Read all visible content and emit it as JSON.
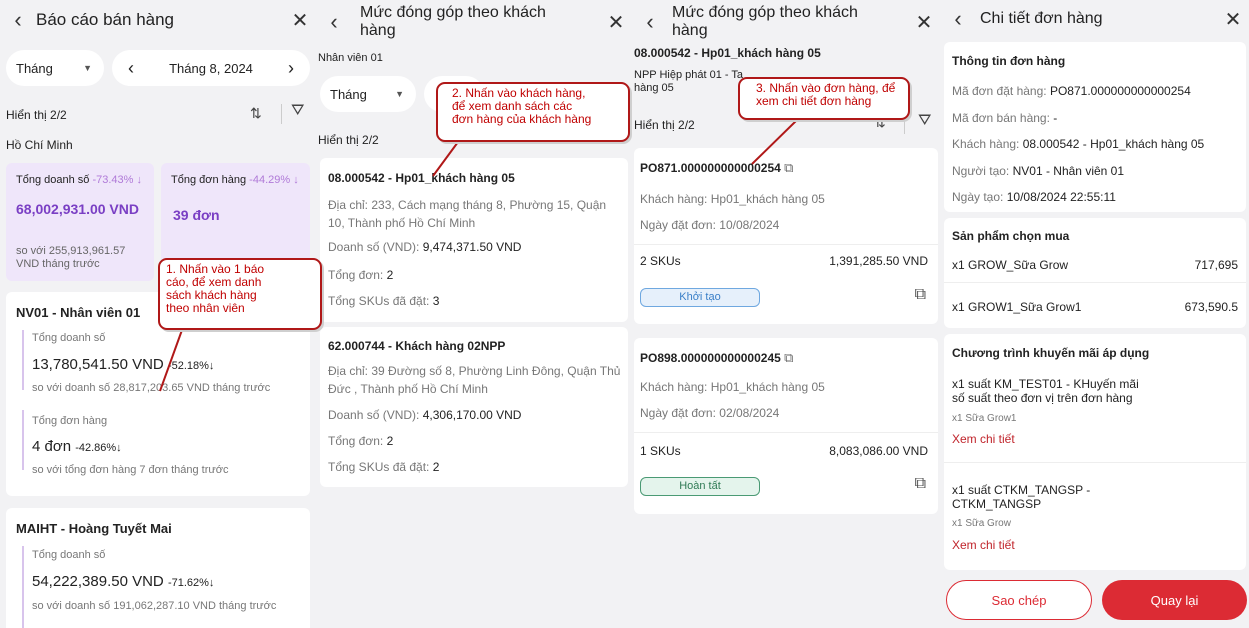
{
  "p1": {
    "title": "Báo cáo bán hàng",
    "period": "Tháng",
    "month": "Tháng 8, 2024",
    "count": "Hiển thị 2/2",
    "region": "Hồ Chí Minh",
    "stat1": {
      "label": "Tổng doanh số",
      "delta": "-73.43% ↓",
      "value": "68,002,931.00 VND",
      "compare": "so với 255,913,961.57 VND tháng trước"
    },
    "stat2": {
      "label": "Tổng đơn hàng",
      "delta": "-44.29% ↓",
      "value": "39 đơn"
    },
    "emp1": {
      "name": "NV01 - Nhân viên 01",
      "rev_label": "Tổng doanh số",
      "rev_value": "13,780,541.50 VND",
      "rev_delta": "-52.18%↓",
      "rev_compare": "so với doanh số 28,817,203.65 VND tháng trước",
      "ord_label": "Tổng đơn hàng",
      "ord_value": "4 đơn",
      "ord_delta": "-42.86%↓",
      "ord_compare": "so với tổng đơn hàng 7 đơn tháng trước"
    },
    "emp2": {
      "name": "MAIHT - Hoàng Tuyết Mai",
      "rev_label": "Tổng doanh số",
      "rev_value": "54,222,389.50 VND",
      "rev_delta": "-71.62%↓",
      "rev_compare": "so với doanh số 191,062,287.10 VND tháng trước"
    }
  },
  "p2": {
    "title": "Mức đóng góp theo khách hàng",
    "employee": "Nhân viên 01",
    "period": "Tháng",
    "count": "Hiển thị 2/2",
    "c1": {
      "name": "08.000542 - Hp01_khách hàng 05",
      "addr": "Địa chỉ: 233, Cách mạng tháng 8, Phường 15, Quận 10, Thành phố Hồ Chí Minh",
      "rev_label": "Doanh số (VND):",
      "rev": "9,474,371.50 VND",
      "ord_label": "Tổng đơn:",
      "ord": "2",
      "sku_label": "Tổng SKUs đã đặt:",
      "sku": "3"
    },
    "c2": {
      "name": "62.000744 - Khách hàng 02NPP",
      "addr": "Địa chỉ: 39 Đường số 8, Phường Linh Đông, Quận Thủ Đức , Thành phố Hồ Chí Minh",
      "rev_label": "Doanh số (VND):",
      "rev": "4,306,170.00 VND",
      "ord_label": "Tổng đơn:",
      "ord": "2",
      "sku_label": "Tổng SKUs đã đặt:",
      "sku": "2"
    }
  },
  "p3": {
    "title": "Mức đóng góp theo khách hàng",
    "customer": "08.000542 - Hp01_khách hàng 05",
    "npp": "NPP Hiệp phát 01 - Ta",
    "npp_tail": "hàng 05",
    "count": "Hiển thị 2/2",
    "o1": {
      "code": "PO871.000000000000254",
      "cust_label": "Khách hàng:",
      "cust": "Hp01_khách hàng 05",
      "date_label": "Ngày đặt đơn:",
      "date": "10/08/2024",
      "skus": "2 SKUs",
      "amount": "1,391,285.50 VND",
      "status": "Khởi tạo"
    },
    "o2": {
      "code": "PO898.000000000000245",
      "cust_label": "Khách hàng:",
      "cust": "Hp01_khách hàng 05",
      "date_label": "Ngày đặt đơn:",
      "date": "02/08/2024",
      "skus": "1 SKUs",
      "amount": "8,083,086.00 VND",
      "status": "Hoàn tất"
    }
  },
  "p4": {
    "title": "Chi tiết đơn hàng",
    "info_title": "Thông tin đơn hàng",
    "order_label": "Mã đơn đặt hàng:",
    "order": "PO871.000000000000254",
    "sale_label": "Mã đơn bán hàng:",
    "sale": "-",
    "cust_label": "Khách hàng:",
    "cust": "08.000542 - Hp01_khách hàng 05",
    "creator_label": "Người tạo:",
    "creator": "NV01 - Nhân viên 01",
    "created_label": "Ngày tạo:",
    "created": "10/08/2024 22:55:11",
    "prod_title": "Sản phẩm chọn mua",
    "prod1": "x1 GROW_Sữa Grow",
    "prod1_price": "717,695",
    "prod2": "x1 GROW1_Sữa Grow1",
    "prod2_price": "673,590.5",
    "promo_title": "Chương trình khuyến mãi áp dụng",
    "promo1a": "x1 suất KM_TEST01 - KHuyến mãi",
    "promo1b": "số suất theo đơn vị trên đơn hàng",
    "promo1_sub": "x1 Sữa Grow1",
    "promo1_link": "Xem chi tiết",
    "promo2a": "x1 suất CTKM_TANGSP -",
    "promo2b": "CTKM_TANGSP",
    "promo2_sub": "x1 Sữa Grow",
    "promo2_link": "Xem chi tiết",
    "btn_copy": "Sao chép",
    "btn_back": "Quay lại"
  },
  "callouts": {
    "c1a": "1. Nhấn vào 1 báo",
    "c1b": "cáo, để xem danh",
    "c1c": "sách khách hàng",
    "c1d": "theo nhân viên",
    "c2a": "2. Nhấn vào khách hàng,",
    "c2b": "để xem danh sách các",
    "c2c": "đơn hàng của khách hàng",
    "c3a": "3. Nhấn vào đơn hàng, để",
    "c3b": "xem chi tiết đơn hàng"
  },
  "colors": {
    "accent": "#7a3fc4",
    "red": "#dc2b34",
    "stat_bg": "#efe6fa",
    "chip_init": "#e6f0fb",
    "chip_done": "#e4f4ec"
  }
}
